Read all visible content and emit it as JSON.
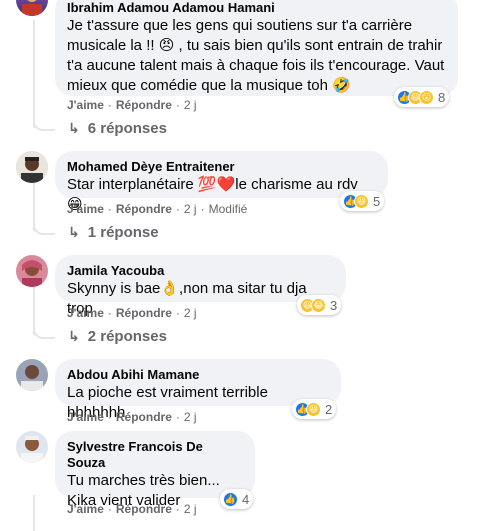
{
  "comments": [
    {
      "author": "Ibrahim Adamou Adamou Hamani",
      "lines": [
        "Je t'assure que les gens qui soutiens sur t'a carrière",
        "musicale la !! 😠 , tu sais bien qu'ils sont entrain de trahir",
        "t'a aucune talent mais à chaque fois ils t'encourage. Vaut",
        "mieux que comédie que la musique toh 🤣"
      ],
      "reaction_count": "8",
      "reactions": [
        "like",
        "haha",
        "wow"
      ],
      "like": "J'aime",
      "reply": "Répondre",
      "time": "2 j",
      "replies": "6 réponses"
    },
    {
      "author": "Mohamed Dèye Entraitener",
      "lines": [
        "Star interplanétaire 💯❤️le charisme au rdv 😁"
      ],
      "reaction_count": "5",
      "reactions": [
        "like",
        "haha"
      ],
      "like": "J'aime",
      "reply": "Répondre",
      "time": "2 j",
      "edited": "Modifié",
      "replies": "1 réponse"
    },
    {
      "author": "Jamila Yacouba",
      "lines": [
        "Skynny is bae👌,non ma sitar tu dja trop"
      ],
      "reaction_count": "3",
      "reactions": [
        "haha",
        "haha"
      ],
      "like": "J'aime",
      "reply": "Répondre",
      "time": "2 j",
      "replies": "2 réponses"
    },
    {
      "author": "Abdou Abihi Mamane",
      "lines": [
        "La pioche est vraiment terrible hhhhhhh"
      ],
      "reaction_count": "2",
      "reactions": [
        "like",
        "haha"
      ],
      "like": "J'aime",
      "reply": "Répondre",
      "time": "2 j"
    },
    {
      "author": "Sylvestre Francois De Souza",
      "lines": [
        "Tu marches très bien...",
        "Kika vient valider"
      ],
      "reaction_count": "4",
      "reactions": [
        "like"
      ],
      "like": "J'aime",
      "reply": "Répondre",
      "time": "2 j"
    }
  ],
  "colors": {
    "bubble": "#f0f2f5",
    "meta": "#65676b",
    "like": "#1877f2",
    "haha": "#f7c430"
  }
}
